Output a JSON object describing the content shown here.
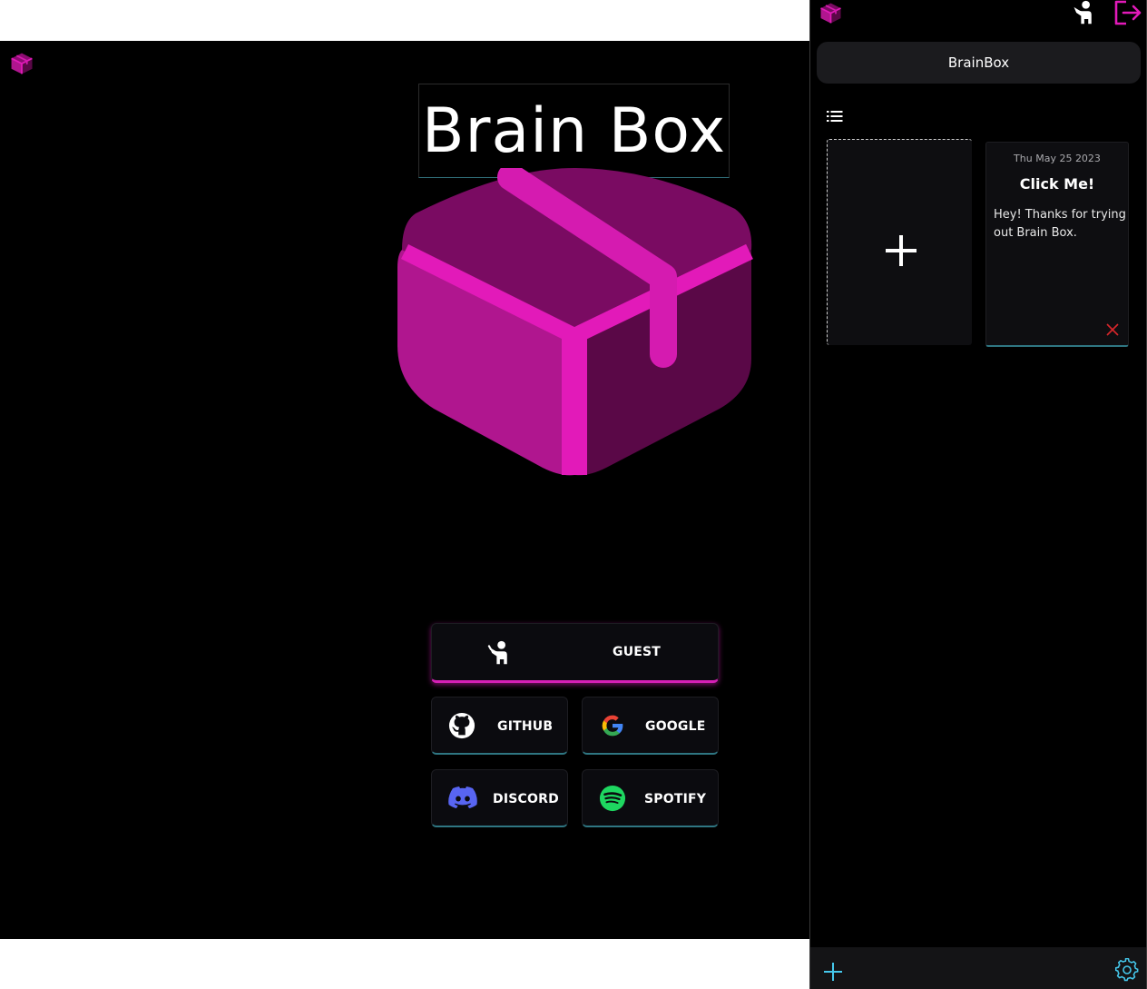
{
  "main": {
    "title": "Brain Box",
    "buttons": {
      "guest": "GUEST",
      "github": "GITHUB",
      "google": "GOOGLE",
      "discord": "DISCORD",
      "spotify": "SPOTIFY"
    },
    "icons": [
      "box-logo-icon",
      "guest-user-icon",
      "github-icon",
      "google-icon",
      "discord-icon",
      "spotify-icon"
    ]
  },
  "panel": {
    "title": "BrainBox",
    "note": {
      "date": "Thu May 25 2023",
      "title": "Click Me!",
      "body": "Hey! Thanks for trying out Brain Box."
    },
    "icons": [
      "box-logo-icon",
      "user-icon",
      "logout-icon",
      "list-icon",
      "plus-icon",
      "close-icon",
      "gear-icon"
    ]
  },
  "colors": {
    "accent_magenta": "#d61fb6",
    "accent_cyan": "#2f7682",
    "icon_cyan": "#45c8ec",
    "delete_red": "#d8262b"
  }
}
